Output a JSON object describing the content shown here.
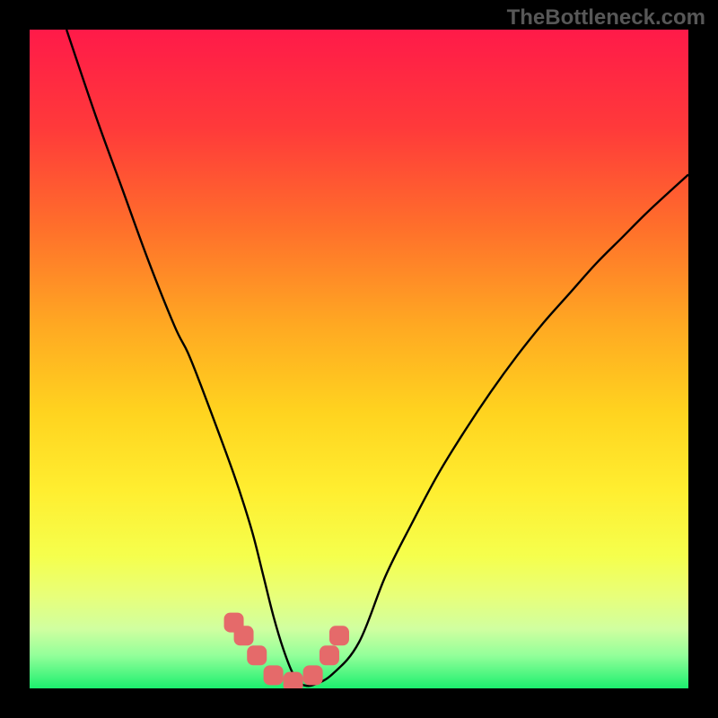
{
  "watermark": "TheBottleneck.com",
  "chart_data": {
    "type": "line",
    "title": "",
    "xlabel": "",
    "ylabel": "",
    "xlim": [
      0,
      100
    ],
    "ylim": [
      0,
      100
    ],
    "x": [
      5.6,
      10,
      14,
      18,
      22,
      24,
      26,
      29,
      31,
      32.5,
      34,
      35.5,
      37,
      38.5,
      40,
      41.5,
      43,
      46,
      50,
      54,
      58,
      62,
      66,
      70,
      74,
      78,
      82,
      86,
      90,
      94,
      100
    ],
    "values": [
      100,
      87,
      76,
      65,
      55,
      51,
      46,
      38,
      32.5,
      28,
      23,
      17,
      11,
      6,
      2.2,
      0.5,
      0.5,
      2.2,
      7,
      17,
      25,
      32.5,
      39,
      45,
      50.5,
      55.5,
      60,
      64.5,
      68.5,
      72.5,
      78
    ],
    "gradient_stops": [
      {
        "pos": 0.0,
        "color": "#ff1a49"
      },
      {
        "pos": 0.15,
        "color": "#ff3a3a"
      },
      {
        "pos": 0.3,
        "color": "#ff6f2b"
      },
      {
        "pos": 0.45,
        "color": "#ffa922"
      },
      {
        "pos": 0.58,
        "color": "#ffd31f"
      },
      {
        "pos": 0.7,
        "color": "#ffee30"
      },
      {
        "pos": 0.8,
        "color": "#f5ff4d"
      },
      {
        "pos": 0.86,
        "color": "#e8ff7a"
      },
      {
        "pos": 0.91,
        "color": "#d0ffa0"
      },
      {
        "pos": 0.95,
        "color": "#93ff9a"
      },
      {
        "pos": 1.0,
        "color": "#1cef6e"
      }
    ],
    "marker_points": [
      {
        "x": 31,
        "y": 10
      },
      {
        "x": 32.5,
        "y": 8
      },
      {
        "x": 34.5,
        "y": 5
      },
      {
        "x": 37,
        "y": 2
      },
      {
        "x": 40,
        "y": 1
      },
      {
        "x": 43,
        "y": 2
      },
      {
        "x": 45.5,
        "y": 5
      },
      {
        "x": 47,
        "y": 8
      }
    ]
  }
}
